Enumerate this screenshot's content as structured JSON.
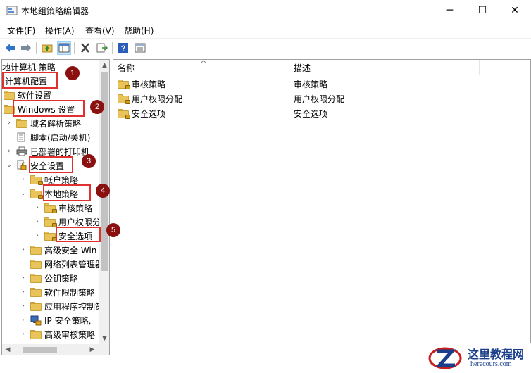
{
  "window": {
    "title": "本地组策略编辑器",
    "controls": {
      "minimize": "─",
      "maximize": "☐",
      "close": "✕"
    }
  },
  "menu": [
    "文件(F)",
    "操作(A)",
    "查看(V)",
    "帮助(H)"
  ],
  "toolbar": {
    "buttons": [
      "back-icon",
      "forward-icon",
      "up-folder-icon",
      "show-hide-tree-icon",
      "delete-icon",
      "export-list-icon",
      "help-icon",
      "properties-icon"
    ]
  },
  "tree": {
    "root_label": "地计算机 策略",
    "items": [
      {
        "label": "计算机配置",
        "icon": "computer-config",
        "expander": ""
      },
      {
        "label": "软件设置",
        "icon": "folder",
        "expander": ""
      },
      {
        "label": "Windows 设置",
        "icon": "folder",
        "expander": ""
      },
      {
        "label": "域名解析策略",
        "icon": "folder",
        "expander": "›"
      },
      {
        "label": "脚本(启动/关机)",
        "icon": "script",
        "expander": ""
      },
      {
        "label": "已部署的打印机",
        "icon": "printer",
        "expander": "›"
      },
      {
        "label": "安全设置",
        "icon": "security",
        "expander": "⌄"
      },
      {
        "label": "帐户策略",
        "icon": "lock-folder",
        "expander": "›"
      },
      {
        "label": "本地策略",
        "icon": "lock-folder",
        "expander": "⌄"
      },
      {
        "label": "审核策略",
        "icon": "lock-folder",
        "expander": "›"
      },
      {
        "label": "用户权限分",
        "icon": "lock-folder",
        "expander": "›"
      },
      {
        "label": "安全选项",
        "icon": "lock-folder",
        "expander": "›"
      },
      {
        "label": "高级安全 Win",
        "icon": "folder",
        "expander": "›"
      },
      {
        "label": "网络列表管理器",
        "icon": "folder",
        "expander": ""
      },
      {
        "label": "公钥策略",
        "icon": "folder",
        "expander": "›"
      },
      {
        "label": "软件限制策略",
        "icon": "folder",
        "expander": "›"
      },
      {
        "label": "应用程序控制策",
        "icon": "folder",
        "expander": "›"
      },
      {
        "label": "IP 安全策略,",
        "icon": "ip-security",
        "expander": "›"
      },
      {
        "label": "高级审核策略",
        "icon": "folder",
        "expander": "›"
      }
    ]
  },
  "list": {
    "columns": [
      "名称",
      "描述"
    ],
    "rows": [
      {
        "name": "审核策略",
        "description": "审核策略"
      },
      {
        "name": "用户权限分配",
        "description": "用户权限分配"
      },
      {
        "name": "安全选项",
        "description": "安全选项"
      }
    ]
  },
  "callouts": [
    "1",
    "2",
    "3",
    "4",
    "5"
  ],
  "watermark": {
    "title": "这里教程网",
    "url": "herecours.com"
  },
  "colors": {
    "callout_border": "#e0302f",
    "badge": "#8b1010",
    "folder": "#e8c45a",
    "selection": "#cce8ff"
  }
}
